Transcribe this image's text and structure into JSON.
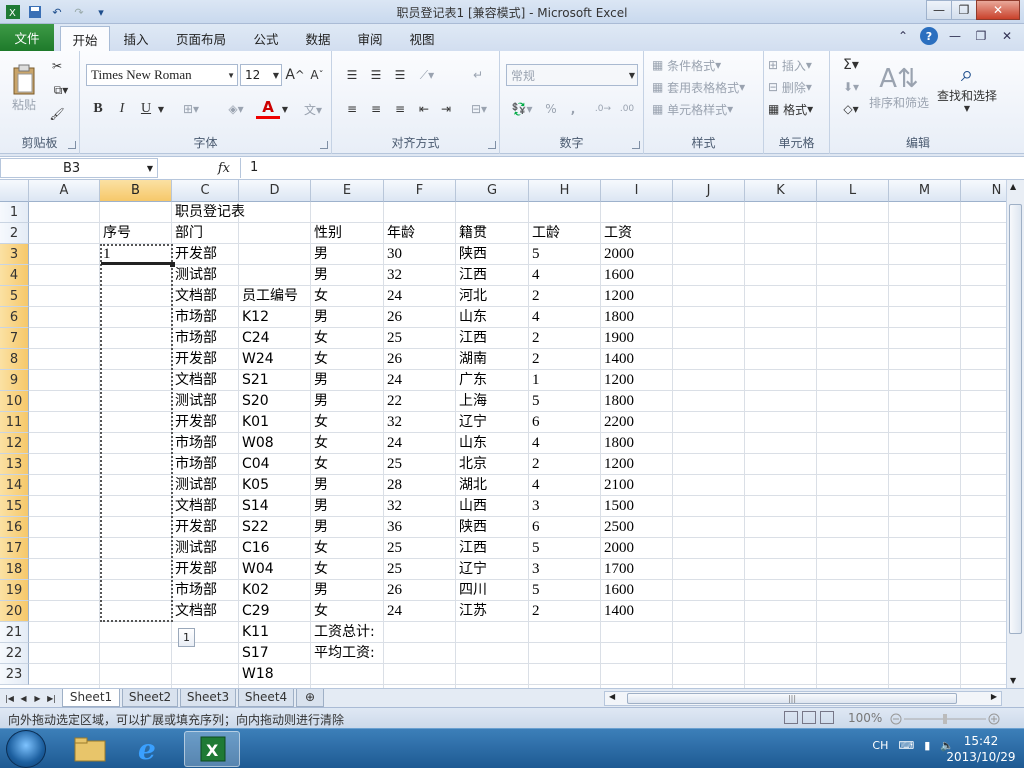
{
  "title_bar": {
    "title": "职员登记表1  [兼容模式]  -  Microsoft Excel"
  },
  "tabs": [
    "文件",
    "开始",
    "插入",
    "页面布局",
    "公式",
    "数据",
    "审阅",
    "视图"
  ],
  "ribbon": {
    "clipboard": {
      "label": "剪贴板",
      "paste": "粘贴"
    },
    "font": {
      "label": "字体",
      "font_name": "Times New Roman",
      "font_size": "12",
      "grow": "A",
      "shrink": "A",
      "bold": "B",
      "italic": "I",
      "underline": "U"
    },
    "alignment": {
      "label": "对齐方式"
    },
    "number": {
      "label": "数字",
      "format": "常规",
      "percent": "%",
      "comma": ","
    },
    "styles": {
      "label": "样式",
      "conditional": "条件格式",
      "table": "套用表格格式",
      "cell_styles": "单元格样式"
    },
    "cells": {
      "label": "单元格",
      "insert": "插入",
      "delete": "删除",
      "format": "格式"
    },
    "editing": {
      "label": "编辑",
      "sort_filter": "排序和筛选",
      "find_select": "查找和选择",
      "sigma": "Σ"
    }
  },
  "formula_bar": {
    "name_box": "B3",
    "fx": "fx",
    "content": "1"
  },
  "columns": [
    "A",
    "B",
    "C",
    "D",
    "E",
    "F",
    "G",
    "H",
    "I",
    "J",
    "K",
    "L",
    "M",
    "N"
  ],
  "rows": [
    "1",
    "2",
    "3",
    "4",
    "5",
    "6",
    "7",
    "8",
    "9",
    "10",
    "11",
    "12",
    "13",
    "14",
    "15",
    "16",
    "17",
    "18",
    "19",
    "20",
    "21",
    "22",
    "23"
  ],
  "cells": {
    "C1": "职员登记表",
    "B2": "序号",
    "C2": "部门",
    "E2": "性别",
    "F2": "年龄",
    "G2": "籍贯",
    "H2": "工龄",
    "I2": "工资",
    "B3": "1",
    "D5": "员工编号",
    "C3": "开发部",
    "E3": "男",
    "F3": "30",
    "G3": "陕西",
    "H3": "5",
    "I3": "2000",
    "C4": "测试部",
    "E4": "男",
    "F4": "32",
    "G4": "江西",
    "H4": "4",
    "I4": "1600",
    "C5": "文档部",
    "E5": "女",
    "F5": "24",
    "G5": "河北",
    "H5": "2",
    "I5": "1200",
    "C6": "市场部",
    "D6": "K12",
    "E6": "男",
    "F6": "26",
    "G6": "山东",
    "H6": "4",
    "I6": "1800",
    "C7": "市场部",
    "D7": "C24",
    "E7": "女",
    "F7": "25",
    "G7": "江西",
    "H7": "2",
    "I7": "1900",
    "C8": "开发部",
    "D8": "W24",
    "E8": "女",
    "F8": "26",
    "G8": "湖南",
    "H8": "2",
    "I8": "1400",
    "C9": "文档部",
    "D9": "S21",
    "E9": "男",
    "F9": "24",
    "G9": "广东",
    "H9": "1",
    "I9": "1200",
    "C10": "测试部",
    "D10": "S20",
    "E10": "男",
    "F10": "22",
    "G10": "上海",
    "H10": "5",
    "I10": "1800",
    "C11": "开发部",
    "D11": "K01",
    "E11": "女",
    "F11": "32",
    "G11": "辽宁",
    "H11": "6",
    "I11": "2200",
    "C12": "市场部",
    "D12": "W08",
    "E12": "女",
    "F12": "24",
    "G12": "山东",
    "H12": "4",
    "I12": "1800",
    "C13": "市场部",
    "D13": "C04",
    "E13": "女",
    "F13": "25",
    "G13": "北京",
    "H13": "2",
    "I13": "1200",
    "C14": "测试部",
    "D14": "K05",
    "E14": "男",
    "F14": "28",
    "G14": "湖北",
    "H14": "4",
    "I14": "2100",
    "C15": "文档部",
    "D15": "S14",
    "E15": "男",
    "F15": "32",
    "G15": "山西",
    "H15": "3",
    "I15": "1500",
    "C16": "开发部",
    "D16": "S22",
    "E16": "男",
    "F16": "36",
    "G16": "陕西",
    "H16": "6",
    "I16": "2500",
    "C17": "测试部",
    "D17": "C16",
    "E17": "女",
    "F17": "25",
    "G17": "江西",
    "H17": "5",
    "I17": "2000",
    "C18": "开发部",
    "D18": "W04",
    "E18": "女",
    "F18": "25",
    "G18": "辽宁",
    "H18": "3",
    "I18": "1700",
    "C19": "市场部",
    "D19": "K02",
    "E19": "男",
    "F19": "26",
    "G19": "四川",
    "H19": "5",
    "I19": "1600",
    "C20": "文档部",
    "D20": "C29",
    "E20": "女",
    "F20": "24",
    "G20": "江苏",
    "H20": "2",
    "I20": "1400",
    "D21": "K11",
    "E21": "工资总计:",
    "D22": "S17",
    "E22": "平均工资:",
    "D23": "W18"
  },
  "autofill_icon": "1",
  "sheet_tabs": [
    "Sheet1",
    "Sheet2",
    "Sheet3",
    "Sheet4"
  ],
  "status_bar": {
    "text": "向外拖动选定区域，可以扩展或填充序列；向内拖动则进行清除",
    "zoom": "100%"
  },
  "taskbar": {
    "lang": "CH",
    "time": "15:42",
    "date": "2013/10/29"
  },
  "colors": {
    "file_tab": "#1e7a2b",
    "selection_header": "#f6c86a"
  }
}
